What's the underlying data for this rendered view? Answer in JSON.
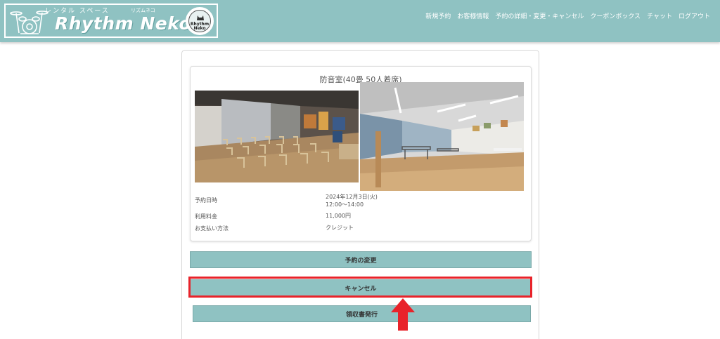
{
  "header": {
    "logo_text": "Rhythm Neko",
    "logo_kana": "レンタル スペース",
    "logo_kana2": "リズムネコ",
    "seal_text_line1": "Rhythm",
    "seal_text_line2": "Neko",
    "nav": [
      {
        "label": "新規予約"
      },
      {
        "label": "お客様情報"
      },
      {
        "label": "予約の詳細・変更・キャンセル"
      },
      {
        "label": "クーポンボックス"
      },
      {
        "label": "チャット"
      },
      {
        "label": "ログアウト"
      }
    ]
  },
  "room": {
    "title": "防音室(40畳 50人着席)",
    "rows": [
      {
        "label": "予約日時",
        "value_line1": "2024年12月3日(火)",
        "value_line2": "12:00〜14:00"
      },
      {
        "label": "利用料金",
        "value_line1": "11,000円"
      },
      {
        "label": "お支払い方法",
        "value_line1": "クレジット"
      }
    ]
  },
  "buttons": {
    "change": "予約の変更",
    "cancel": "キャンセル",
    "receipt": "領収書発行"
  },
  "colors": {
    "header_bg": "#8fc2c2",
    "button_bg": "#8fc2c2",
    "highlight": "#e8232a"
  }
}
